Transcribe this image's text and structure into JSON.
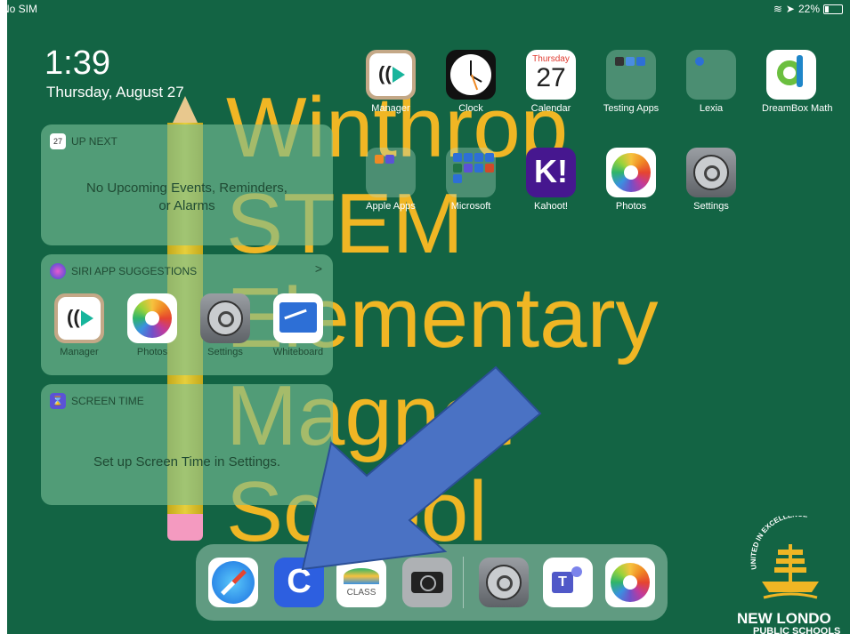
{
  "status_bar": {
    "carrier": "No SIM",
    "battery": "22%"
  },
  "lock": {
    "time": "1:39",
    "date": "Thursday, August 27"
  },
  "wallpaper": {
    "line1": "Winthrop",
    "line2": "STEM",
    "line3": "Elementary",
    "line4": "Magnet",
    "line5": "School"
  },
  "home_apps": [
    {
      "label": "Manager"
    },
    {
      "label": "Clock"
    },
    {
      "label": "Calendar",
      "calendar_day": "Thursday",
      "calendar_num": "27"
    },
    {
      "label": "Testing Apps"
    },
    {
      "label": "Lexia"
    },
    {
      "label": "DreamBox Math"
    },
    {
      "label": "Apple Apps"
    },
    {
      "label": "Microsoft"
    },
    {
      "label": "Kahoot!"
    },
    {
      "label": "Photos"
    },
    {
      "label": "Settings"
    }
  ],
  "widgets": {
    "up_next": {
      "title": "UP NEXT",
      "icon_num": "27",
      "message_line1": "No Upcoming Events, Reminders,",
      "message_line2": "or Alarms"
    },
    "siri": {
      "title": "SIRI APP SUGGESTIONS",
      "chevron": ">",
      "apps": [
        {
          "label": "Manager"
        },
        {
          "label": "Photos"
        },
        {
          "label": "Settings"
        },
        {
          "label": "Whiteboard"
        }
      ]
    },
    "screen_time": {
      "title": "SCREEN TIME",
      "message": "Set up Screen Time in Settings."
    }
  },
  "dock": {
    "apps": [
      {
        "name": "safari-icon"
      },
      {
        "name": "clever-icon",
        "glyph": "C"
      },
      {
        "name": "class-icon",
        "glyph": "CLASS"
      },
      {
        "name": "camera-icon"
      },
      {
        "name": "settings-icon"
      },
      {
        "name": "teams-icon",
        "glyph": "T"
      },
      {
        "name": "photos-icon"
      }
    ]
  },
  "logo": {
    "arc_text": "UNITED IN EXCELLENCE",
    "name": "NEW LONDO",
    "sub": "PUBLIC SCHOOLS"
  },
  "colors": {
    "background": "#136444",
    "wallpaper_text": "#f0b624",
    "arrow": "#4a72c4"
  }
}
